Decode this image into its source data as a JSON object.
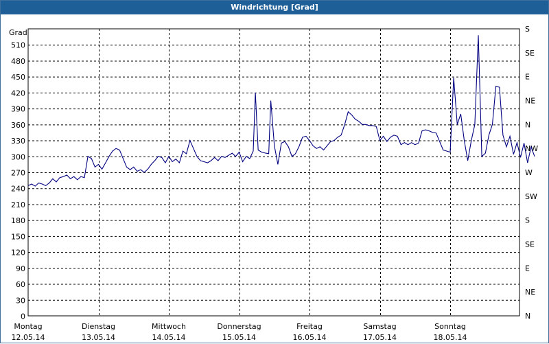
{
  "title": "Windrichtung [Grad]",
  "chart_data": {
    "type": "line",
    "title": "Windrichtung [Grad]",
    "ylabel": "Grad",
    "ylim": [
      0,
      540
    ],
    "y_ticks": [
      0,
      30,
      60,
      90,
      120,
      150,
      180,
      210,
      240,
      270,
      300,
      330,
      360,
      390,
      420,
      450,
      480,
      510
    ],
    "right_ticks": [
      "N",
      "NE",
      "E",
      "SE",
      "S",
      "SW",
      "W",
      "NW",
      "N",
      "NE",
      "E",
      "SE",
      "S"
    ],
    "right_ticks_top_label": "S",
    "x_categories": [
      {
        "day": "Montag",
        "date": "12.05.14"
      },
      {
        "day": "Dienstag",
        "date": "13.05.14"
      },
      {
        "day": "Mittwoch",
        "date": "14.05.14"
      },
      {
        "day": "Donnerstag",
        "date": "15.05.14"
      },
      {
        "day": "Freitag",
        "date": "16.05.14"
      },
      {
        "day": "Samstag",
        "date": "17.05.14"
      },
      {
        "day": "Sonntag",
        "date": "18.05.14"
      }
    ],
    "grid": true,
    "series": [
      {
        "color": "#000080",
        "points": [
          [
            0.0,
            245
          ],
          [
            0.05,
            248
          ],
          [
            0.1,
            244
          ],
          [
            0.15,
            250
          ],
          [
            0.2,
            248
          ],
          [
            0.25,
            245
          ],
          [
            0.3,
            250
          ],
          [
            0.35,
            258
          ],
          [
            0.4,
            252
          ],
          [
            0.45,
            260
          ],
          [
            0.5,
            262
          ],
          [
            0.55,
            265
          ],
          [
            0.6,
            258
          ],
          [
            0.65,
            262
          ],
          [
            0.7,
            256
          ],
          [
            0.75,
            262
          ],
          [
            0.8,
            260
          ],
          [
            0.85,
            300
          ],
          [
            0.9,
            296
          ],
          [
            0.95,
            280
          ],
          [
            1.0,
            285
          ],
          [
            1.05,
            276
          ],
          [
            1.1,
            288
          ],
          [
            1.15,
            300
          ],
          [
            1.2,
            310
          ],
          [
            1.25,
            315
          ],
          [
            1.3,
            312
          ],
          [
            1.35,
            296
          ],
          [
            1.4,
            280
          ],
          [
            1.45,
            275
          ],
          [
            1.5,
            280
          ],
          [
            1.55,
            272
          ],
          [
            1.6,
            275
          ],
          [
            1.65,
            270
          ],
          [
            1.7,
            276
          ],
          [
            1.75,
            285
          ],
          [
            1.8,
            292
          ],
          [
            1.85,
            300
          ],
          [
            1.9,
            298
          ],
          [
            1.95,
            288
          ],
          [
            2.0,
            300
          ],
          [
            2.05,
            290
          ],
          [
            2.1,
            295
          ],
          [
            2.15,
            288
          ],
          [
            2.2,
            310
          ],
          [
            2.25,
            305
          ],
          [
            2.3,
            330
          ],
          [
            2.35,
            315
          ],
          [
            2.4,
            300
          ],
          [
            2.45,
            292
          ],
          [
            2.5,
            290
          ],
          [
            2.55,
            288
          ],
          [
            2.6,
            292
          ],
          [
            2.65,
            298
          ],
          [
            2.7,
            292
          ],
          [
            2.75,
            300
          ],
          [
            2.8,
            298
          ],
          [
            2.85,
            302
          ],
          [
            2.9,
            306
          ],
          [
            2.95,
            300
          ],
          [
            3.0,
            308
          ],
          [
            3.05,
            290
          ],
          [
            3.1,
            300
          ],
          [
            3.15,
            296
          ],
          [
            3.2,
            310
          ],
          [
            3.23,
            420
          ],
          [
            3.27,
            312
          ],
          [
            3.32,
            308
          ],
          [
            3.38,
            306
          ],
          [
            3.42,
            305
          ],
          [
            3.45,
            405
          ],
          [
            3.5,
            320
          ],
          [
            3.55,
            285
          ],
          [
            3.6,
            325
          ],
          [
            3.65,
            328
          ],
          [
            3.7,
            318
          ],
          [
            3.75,
            300
          ],
          [
            3.8,
            305
          ],
          [
            3.85,
            318
          ],
          [
            3.9,
            336
          ],
          [
            3.95,
            338
          ],
          [
            4.0,
            330
          ],
          [
            4.05,
            320
          ],
          [
            4.1,
            315
          ],
          [
            4.15,
            318
          ],
          [
            4.2,
            312
          ],
          [
            4.25,
            320
          ],
          [
            4.3,
            328
          ],
          [
            4.35,
            330
          ],
          [
            4.4,
            336
          ],
          [
            4.45,
            340
          ],
          [
            4.5,
            360
          ],
          [
            4.55,
            384
          ],
          [
            4.6,
            378
          ],
          [
            4.65,
            370
          ],
          [
            4.7,
            366
          ],
          [
            4.75,
            360
          ],
          [
            4.8,
            360
          ],
          [
            4.85,
            358
          ],
          [
            4.9,
            358
          ],
          [
            4.95,
            356
          ],
          [
            5.0,
            330
          ],
          [
            5.05,
            338
          ],
          [
            5.1,
            328
          ],
          [
            5.15,
            336
          ],
          [
            5.2,
            340
          ],
          [
            5.25,
            338
          ],
          [
            5.3,
            322
          ],
          [
            5.35,
            326
          ],
          [
            5.4,
            322
          ],
          [
            5.45,
            326
          ],
          [
            5.5,
            322
          ],
          [
            5.55,
            325
          ],
          [
            5.6,
            348
          ],
          [
            5.65,
            350
          ],
          [
            5.7,
            348
          ],
          [
            5.75,
            345
          ],
          [
            5.8,
            344
          ],
          [
            5.85,
            328
          ],
          [
            5.9,
            312
          ],
          [
            5.95,
            310
          ],
          [
            6.0,
            308
          ],
          [
            6.05,
            448
          ],
          [
            6.1,
            360
          ],
          [
            6.15,
            380
          ],
          [
            6.2,
            330
          ],
          [
            6.25,
            292
          ],
          [
            6.3,
            330
          ],
          [
            6.35,
            360
          ],
          [
            6.4,
            528
          ],
          [
            6.45,
            300
          ],
          [
            6.5,
            306
          ],
          [
            6.55,
            340
          ],
          [
            6.6,
            360
          ],
          [
            6.65,
            432
          ],
          [
            6.7,
            430
          ],
          [
            6.75,
            340
          ],
          [
            6.8,
            318
          ],
          [
            6.85,
            338
          ],
          [
            6.9,
            304
          ],
          [
            6.95,
            326
          ],
          [
            7.0,
            298
          ],
          [
            7.05,
            325
          ],
          [
            7.1,
            288
          ],
          [
            7.15,
            318
          ],
          [
            7.2,
            300
          ]
        ]
      }
    ]
  }
}
